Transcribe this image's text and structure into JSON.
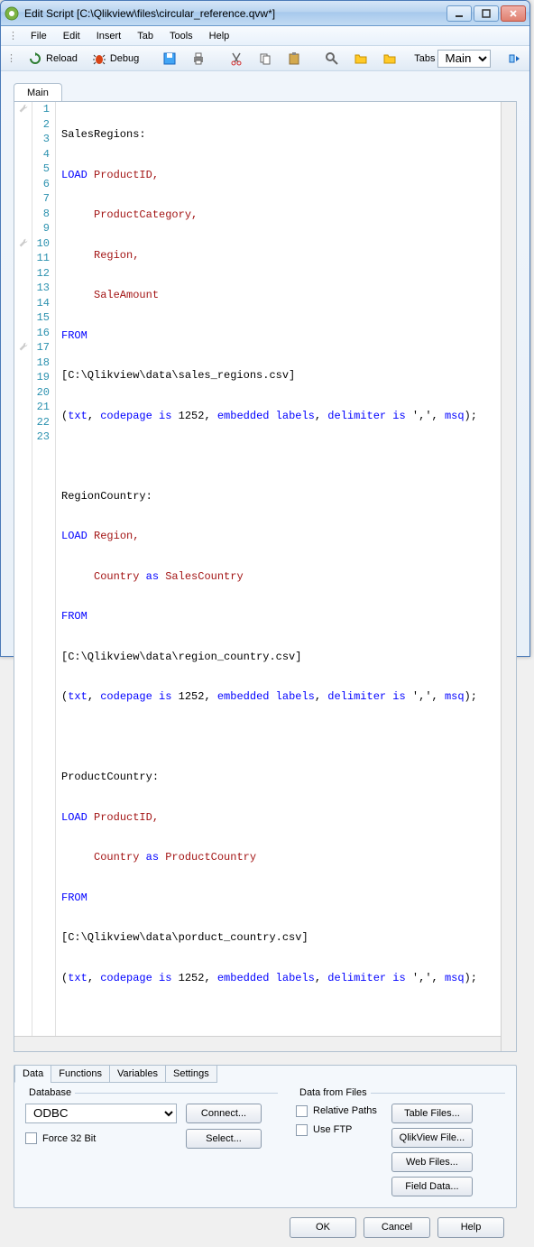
{
  "window": {
    "title": "Edit Script [C:\\Qlikview\\files\\circular_reference.qvw*]"
  },
  "menu": {
    "file": "File",
    "edit": "Edit",
    "insert": "Insert",
    "tab": "Tab",
    "tools": "Tools",
    "help": "Help"
  },
  "toolbar": {
    "reload": "Reload",
    "debug": "Debug",
    "tabs_label": "Tabs",
    "tabs_select": "Main"
  },
  "script_tab": {
    "main": "Main"
  },
  "code": {
    "l1_a": "SalesRegions:",
    "l2_a": "LOAD",
    "l2_b": " ProductID,",
    "l3_a": "     ProductCategory,",
    "l4_a": "     Region,",
    "l5_a": "     SaleAmount",
    "l6_a": "FROM",
    "l7_a": "[C:\\Qlikview\\data\\sales_regions.csv]",
    "l8_a": "(",
    "l8_b": "txt",
    "l8_c": ", ",
    "l8_d": "codepage is",
    "l8_e": " 1252, ",
    "l8_f": "embedded labels",
    "l8_g": ", ",
    "l8_h": "delimiter is",
    "l8_i": " ',', ",
    "l8_j": "msq",
    "l8_k": ");",
    "l10_a": "RegionCountry:",
    "l11_a": "LOAD",
    "l11_b": " Region,",
    "l12_a": "     Country ",
    "l12_b": "as",
    "l12_c": " SalesCountry",
    "l13_a": "FROM",
    "l14_a": "[C:\\Qlikview\\data\\region_country.csv]",
    "l17_a": "ProductCountry:",
    "l18_a": "LOAD",
    "l18_b": " ProductID,",
    "l19_a": "     Country ",
    "l19_b": "as",
    "l19_c": " ProductCountry",
    "l20_a": "FROM",
    "l21_a": "[C:\\Qlikview\\data\\porduct_country.csv]"
  },
  "lower": {
    "tab_data": "Data",
    "tab_functions": "Functions",
    "tab_variables": "Variables",
    "tab_settings": "Settings",
    "database": "Database",
    "data_from_files": "Data from Files",
    "odbc": "ODBC",
    "connect": "Connect...",
    "select": "Select...",
    "force32": "Force 32 Bit",
    "relative": "Relative Paths",
    "useftp": "Use FTP",
    "table_files": "Table Files...",
    "qlikview_file": "QlikView File...",
    "web_files": "Web Files...",
    "field_data": "Field Data..."
  },
  "dialog": {
    "ok": "OK",
    "cancel": "Cancel",
    "help": "Help"
  }
}
